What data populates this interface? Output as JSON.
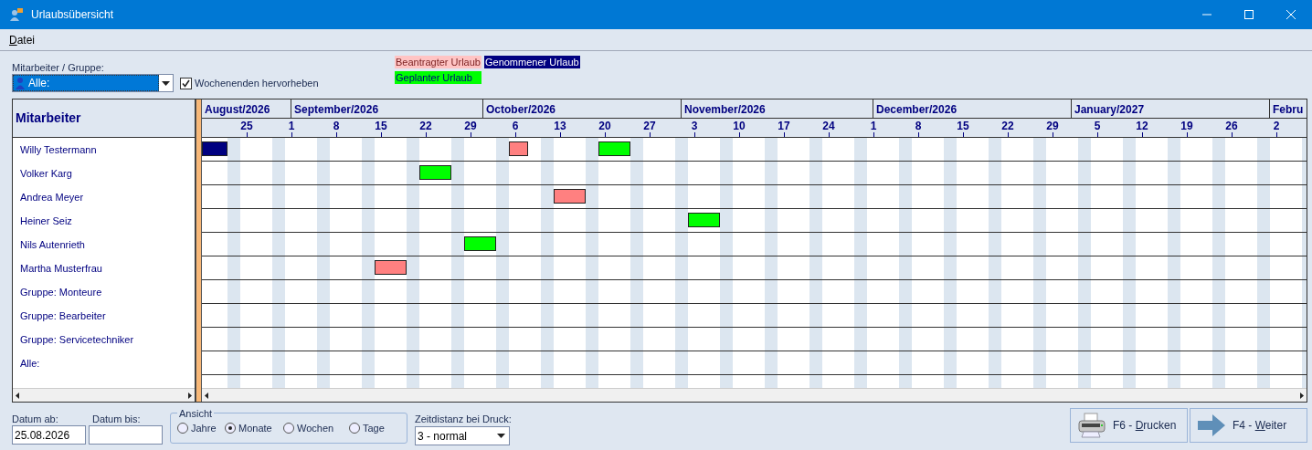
{
  "window": {
    "title": "Urlaubsübersicht"
  },
  "menu": [
    {
      "label": "Datei"
    }
  ],
  "filter": {
    "label": "Mitarbeiter / Gruppe:",
    "value": "Alle:"
  },
  "highlight_weekends": {
    "label": "Wochenenden hervorheben",
    "checked": true
  },
  "legend": [
    {
      "kind": "beantragt",
      "label": "Beantragter Urlaub",
      "color": "#ffc4c4"
    },
    {
      "kind": "genommen",
      "label": "Genommener Urlaub",
      "color": "#000080"
    },
    {
      "kind": "geplant",
      "label": "Geplanter Urlaub",
      "color": "#00ff00"
    }
  ],
  "gantt": {
    "header": "Mitarbeiter",
    "months": [
      "August/2026",
      "September/2026",
      "October/2026",
      "November/2026",
      "December/2026",
      "January/2027",
      "Febru"
    ],
    "week_ticks": [
      "25",
      "1",
      "8",
      "15",
      "22",
      "29",
      "6",
      "13",
      "20",
      "27",
      "3",
      "10",
      "17",
      "24",
      "1",
      "8",
      "15",
      "22",
      "29",
      "5",
      "12",
      "19",
      "26",
      "2"
    ],
    "rows": [
      {
        "name": "Willy Testermann",
        "bars": [
          {
            "kind": "genommen"
          },
          {
            "kind": "beantragt"
          },
          {
            "kind": "geplant"
          }
        ]
      },
      {
        "name": "Volker Karg",
        "bars": [
          {
            "kind": "geplant"
          }
        ]
      },
      {
        "name": "Andrea Meyer",
        "bars": [
          {
            "kind": "beantragt"
          }
        ]
      },
      {
        "name": "Heiner Seiz",
        "bars": [
          {
            "kind": "geplant"
          }
        ]
      },
      {
        "name": "Nils Autenrieth",
        "bars": [
          {
            "kind": "geplant"
          }
        ]
      },
      {
        "name": "Martha Musterfrau",
        "bars": [
          {
            "kind": "beantragt"
          }
        ]
      },
      {
        "name": "Gruppe: Monteure",
        "bars": []
      },
      {
        "name": "Gruppe: Bearbeiter",
        "bars": []
      },
      {
        "name": "Gruppe: Servicetechniker",
        "bars": []
      },
      {
        "name": "Alle:",
        "bars": []
      }
    ]
  },
  "date_from": {
    "label": "Datum ab:",
    "value": "25.08.2026"
  },
  "date_to": {
    "label": "Datum bis:"
  },
  "view": {
    "label": "Ansicht",
    "options": [
      {
        "label": "Jahre",
        "selected": false
      },
      {
        "label": "Monate",
        "selected": true
      },
      {
        "label": "Wochen",
        "selected": false
      },
      {
        "label": "Tage",
        "selected": false
      }
    ]
  },
  "print_distance": {
    "label": "Zeitdistanz bei Druck:",
    "value": "3 - normal"
  },
  "buttons": [
    {
      "kind": "print",
      "label": "F6 - Drucken"
    },
    {
      "kind": "next",
      "label": "F4 - Weiter"
    }
  ]
}
